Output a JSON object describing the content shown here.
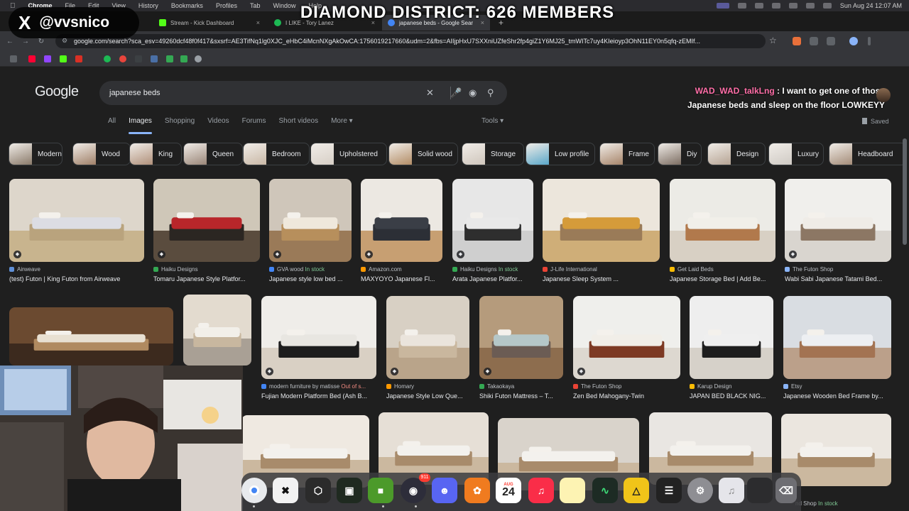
{
  "menubar": {
    "app": "Chrome",
    "items": [
      "File",
      "Edit",
      "View",
      "History",
      "Bookmarks",
      "Profiles",
      "Tab",
      "Window",
      "Help"
    ],
    "clock": "Sun Aug 24  12:07 AM"
  },
  "tabs": [
    {
      "title": "Stream - Kick Dashboard",
      "fav_color": "#53fc18",
      "close": "×"
    },
    {
      "title": "I LIKE - Tory Lanez",
      "fav_color": "#1db954",
      "close": "×"
    },
    {
      "title": "japanese beds - Google Sear",
      "fav_color": "#4285f4",
      "close": "×"
    }
  ],
  "new_tab": "+",
  "address": {
    "url": "google.com/search?sca_esv=49260dcf48f0f417&sxsrf=AE3TifNq1lg0XJC_eHbC4iMcnNXgAkOwCA:1756019217660&udm=2&fbs=AIIjpHxU7SXXniUZfeShr2fp4giZ1Y6MJ25_tmWITc7uy4KIeioyp3OhN11EY0n5qfq-zEMIf..."
  },
  "google": {
    "logo": "Google",
    "query": "japanese beds",
    "menu": [
      "All",
      "Images",
      "Shopping",
      "Videos",
      "Forums",
      "Short videos",
      "More ▾"
    ],
    "active_menu": "Images",
    "tools": "Tools ▾",
    "saved": "Saved"
  },
  "chips": [
    "Modern",
    "Wood",
    "King",
    "Queen",
    "Bedroom",
    "Upholstered",
    "Solid wood",
    "Storage",
    "Low profile",
    "Frame",
    "Diy",
    "Design",
    "Luxury",
    "Headboard"
  ],
  "results_row1": [
    {
      "source": "Airweave",
      "stock": "",
      "title": "(test) Futon | King Futon from Airweave"
    },
    {
      "source": "Haiku Designs",
      "stock": "",
      "title": "Tomaru Japanese Style Platfor..."
    },
    {
      "source": "GVA wood",
      "stock": "In stock",
      "title": "Japanese style low bed ..."
    },
    {
      "source": "Amazon.com",
      "stock": "",
      "title": "MAXYOYO Japanese Fl..."
    },
    {
      "source": "Haiku Designs",
      "stock": "In stock",
      "title": "Arata Japanese Platfor..."
    },
    {
      "source": "J-Life International",
      "stock": "",
      "title": "Japanese Sleep System ..."
    },
    {
      "source": "Get Laid Beds",
      "stock": "",
      "title": "Japanese Storage Bed | Add Be..."
    },
    {
      "source": "The Futon Shop",
      "stock": "",
      "title": "Wabi Sabi Japanese Tatami Bed..."
    }
  ],
  "results_row2": [
    {
      "source": "modern furniture by matisse",
      "stock": "Out of s...",
      "title": "Fujian Modern Platform Bed (Ash B..."
    },
    {
      "source": "Homary",
      "stock": "",
      "title": "Japanese Style Low Que..."
    },
    {
      "source": "Takaokaya",
      "stock": "",
      "title": "Shiki Futon Mattress – T..."
    },
    {
      "source": "The Futon Shop",
      "stock": "",
      "title": "Zen Bed Mahogany-Twin"
    },
    {
      "source": "Karup Design",
      "stock": "",
      "title": "JAPAN BED BLACK NIG..."
    },
    {
      "source": "Etsy",
      "stock": "",
      "title": "Japanese Wooden Bed Frame by..."
    }
  ],
  "row3_last_source": "nd Shop",
  "row3_last_stock": "In stock",
  "overlay": {
    "x_logo": "X",
    "x_handle": "@vvsnico",
    "title": "DIAMOND DISTRICT: 626 MEMBERS",
    "chat_user": "WAD_WAD_talkLng",
    "chat_sep": " : ",
    "chat_message": "I want to get one of those Japanese beds and sleep on the floor LOWKEYY"
  },
  "dock": {
    "discord_badge": "911",
    "calendar_month": "AUG",
    "calendar_day": "24"
  }
}
